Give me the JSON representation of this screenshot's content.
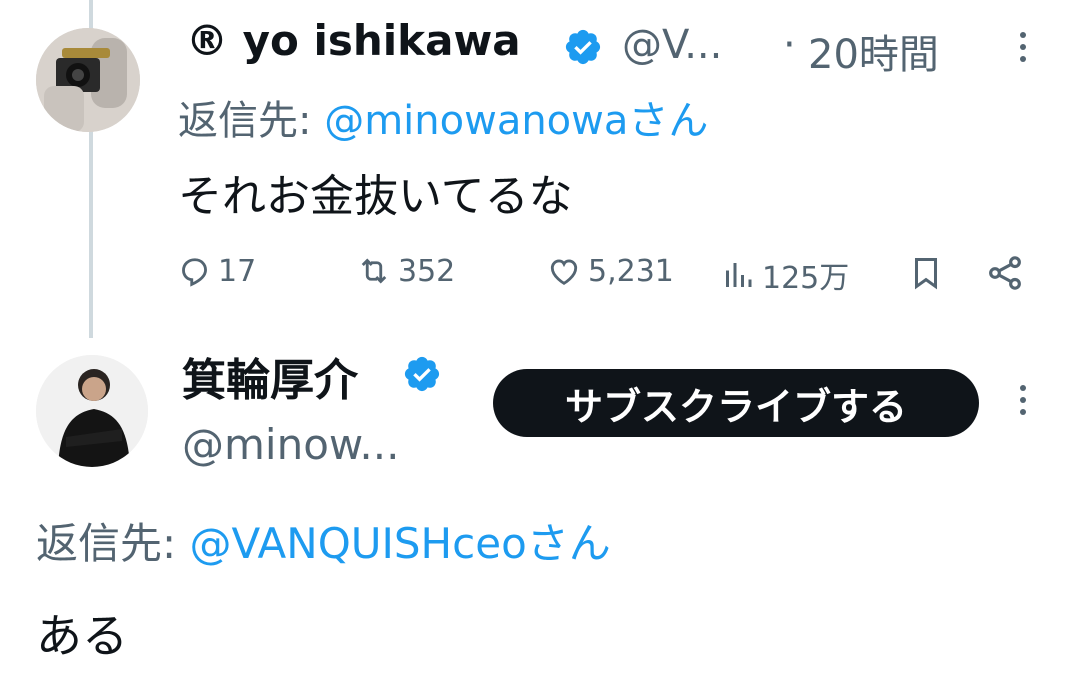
{
  "tweet1": {
    "label_icon": "registered-symbol",
    "display_name": "® yo ishikawa",
    "handle": "@V...",
    "separator": "·",
    "time": "20時間",
    "reply_prefix": "返信先:",
    "reply_to": "@minowanowaさん",
    "text": "それお金抜いてるな",
    "stats": {
      "replies": "17",
      "reposts": "352",
      "likes": "5,231",
      "views": "125万"
    }
  },
  "tweet2": {
    "display_name": "箕輪厚介",
    "handle": "@minow...",
    "subscribe_label": "サブスクライブする",
    "reply_prefix": "返信先:",
    "reply_to": "@VANQUISHceoさん",
    "text": "ある"
  },
  "colors": {
    "accent": "#1d9bf0",
    "text": "#0f1419",
    "secondary": "#536471",
    "thread_line": "#cfd9de",
    "button_bg": "#0f1419"
  },
  "icons": [
    "verified-badge-icon",
    "reply-icon",
    "repost-icon",
    "like-icon",
    "views-icon",
    "bookmark-icon",
    "share-icon",
    "more-icon"
  ]
}
